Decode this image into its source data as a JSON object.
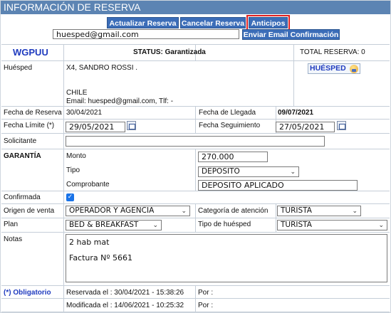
{
  "header": {
    "title": "INFORMACIÓN DE RESERVA"
  },
  "toolbar": {
    "actualizar_label": "Actualizar Reserva",
    "cancelar_label": "Cancelar Reserva",
    "anticipos_label": "Anticipos",
    "email_value": "huesped@gmail.com",
    "enviar_label": "Enviar Email Confirmación"
  },
  "summary": {
    "code": "WGPUU",
    "status": "STATUS: Garantizada",
    "total": "TOTAL RESERVA: 0"
  },
  "guest": {
    "label": "Huésped",
    "name": "X4, SANDRO ROSSI .",
    "country": "CHILE",
    "contact": "Email: huesped@gmail.com, Tlf: -",
    "badge_label": "HUÉSPED"
  },
  "dates": {
    "fecha_reserva_label": "Fecha de Reserva",
    "fecha_reserva_value": "30/04/2021",
    "fecha_llegada_label": "Fecha de Llegada",
    "fecha_llegada_value": "09/07/2021",
    "fecha_limite_label": "Fecha Límite (*)",
    "fecha_limite_value": "29/05/2021",
    "fecha_seguimiento_label": "Fecha Seguimiento",
    "fecha_seguimiento_value": "27/05/2021"
  },
  "solicitante": {
    "label": "Solicitante",
    "value": ""
  },
  "garantia": {
    "label": "GARANTÍA",
    "monto_label": "Monto",
    "monto_value": "270.000",
    "tipo_label": "Tipo",
    "tipo_value": "DEPOSITO",
    "comprobante_label": "Comprobante",
    "comprobante_value": "DEPOSITO APLICADO"
  },
  "confirmada": {
    "label": "Confirmada",
    "checked": true,
    "check_glyph": "✓"
  },
  "origen": {
    "label": "Origen de venta",
    "value": "OPERADOR Y AGENCIA",
    "categoria_label": "Categoría de atención",
    "categoria_value": "TURISTA"
  },
  "plan": {
    "label": "Plan",
    "value": "BED & BREAKFAST",
    "tipo_huesped_label": "Tipo de huésped",
    "tipo_huesped_value": "TURISTA"
  },
  "notas": {
    "label": "Notas",
    "line1": "2 hab mat",
    "line2": "Factura Nº 5661"
  },
  "footer": {
    "obligatorio": "(*) Obligatorio",
    "reservada": "Reservada el : 30/04/2021 - 15:38:26",
    "reservada_por": "Por :",
    "modificada": "Modificada el : 14/06/2021 - 10:25:32",
    "modificada_por": "Por :"
  },
  "icons": {
    "chevron": "chevron-down-icon",
    "calendar": "calendar-icon",
    "guest_face": "guest-face-icon"
  },
  "colors": {
    "header_bg": "#5c84b3",
    "button_bg": "#3b6db8",
    "highlight_outline": "#e02020",
    "code_text": "#1f3bbf",
    "checkbox": "#1a73e8"
  }
}
